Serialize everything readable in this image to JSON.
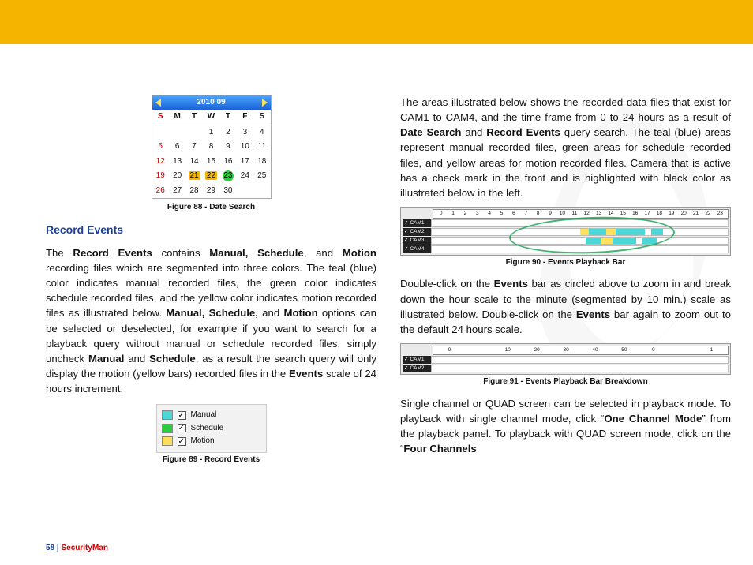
{
  "footer": {
    "page": "58",
    "brand": "SecurityMan"
  },
  "left": {
    "section_title": "Record Events",
    "p1": {
      "b1": "Record Events",
      "b2": "Manual, Schedule",
      "b3": "Motion",
      "b4": "Manual, Schedule,",
      "b5": "Motion",
      "b6": "Manual",
      "b7": "Schedule",
      "b8": "Events"
    }
  },
  "right": {
    "p1": {
      "b1": "Date Search",
      "b2": "Record Events"
    },
    "p2": {
      "b1": "Events",
      "b2": "Events"
    },
    "p3": {
      "b1": "One Channel Mode",
      "b2": "Four Channels"
    }
  },
  "figures": {
    "fig88": {
      "caption": "Figure 88 - Date Search",
      "header": "2010 09",
      "dow": [
        "S",
        "M",
        "T",
        "W",
        "T",
        "F",
        "S"
      ],
      "leading_blanks": 3,
      "days": 30,
      "highlight_orange": [
        21,
        22
      ],
      "highlight_green": [
        23
      ]
    },
    "fig89": {
      "caption": "Figure 89 - Record Events",
      "items": [
        "Manual",
        "Schedule",
        "Motion"
      ]
    },
    "fig90": {
      "caption": "Figure 90 - Events Playback Bar",
      "scale": [
        "0",
        "1",
        "2",
        "3",
        "4",
        "5",
        "6",
        "7",
        "8",
        "9",
        "10",
        "11",
        "12",
        "13",
        "14",
        "15",
        "16",
        "17",
        "18",
        "19",
        "20",
        "21",
        "22",
        "23"
      ],
      "rows": [
        {
          "label": "CAM1",
          "checked": true,
          "segments": []
        },
        {
          "label": "CAM2",
          "checked": true,
          "segments": [
            {
              "type": "y",
              "start": 50,
              "width": 3
            },
            {
              "type": "t",
              "start": 53,
              "width": 6
            },
            {
              "type": "y",
              "start": 59,
              "width": 3
            },
            {
              "type": "t",
              "start": 62,
              "width": 10
            },
            {
              "type": "t",
              "start": 74,
              "width": 4
            }
          ]
        },
        {
          "label": "CAM3",
          "checked": true,
          "segments": [
            {
              "type": "t",
              "start": 52,
              "width": 5
            },
            {
              "type": "y",
              "start": 57,
              "width": 4
            },
            {
              "type": "t",
              "start": 61,
              "width": 8
            },
            {
              "type": "t",
              "start": 71,
              "width": 5
            }
          ]
        },
        {
          "label": "CAM4",
          "checked": true,
          "segments": []
        }
      ]
    },
    "fig91": {
      "caption": "Figure 91 - Events Playback Bar Breakdown",
      "scale": [
        "0",
        "",
        "10",
        "20",
        "30",
        "40",
        "50",
        "0",
        "",
        "1"
      ],
      "rows": [
        {
          "label": "CAM1",
          "checked": true,
          "segments": []
        },
        {
          "label": "CAM2",
          "checked": true,
          "segments": []
        }
      ]
    }
  }
}
